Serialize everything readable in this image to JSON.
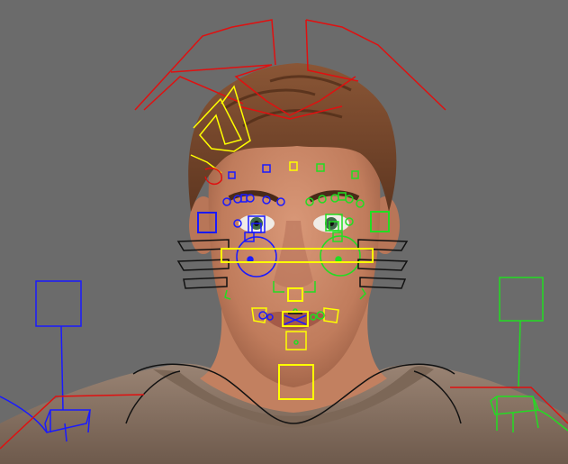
{
  "viewport": {
    "background": "#6b6b6b"
  },
  "colors": {
    "skin": "#c98a6a",
    "skin_shadow": "#a86a4e",
    "hair": "#7a4a2e",
    "hair_dark": "#5b3320",
    "shirt": "#8b7565",
    "ctrl_red": "#e01010",
    "ctrl_yellow": "#ffff00",
    "ctrl_blue": "#1a1aff",
    "ctrl_green": "#22dd22",
    "ctrl_black": "#111111"
  },
  "controls": {
    "left_side": "blue",
    "right_side": "green",
    "center": "yellow",
    "root": "red"
  }
}
